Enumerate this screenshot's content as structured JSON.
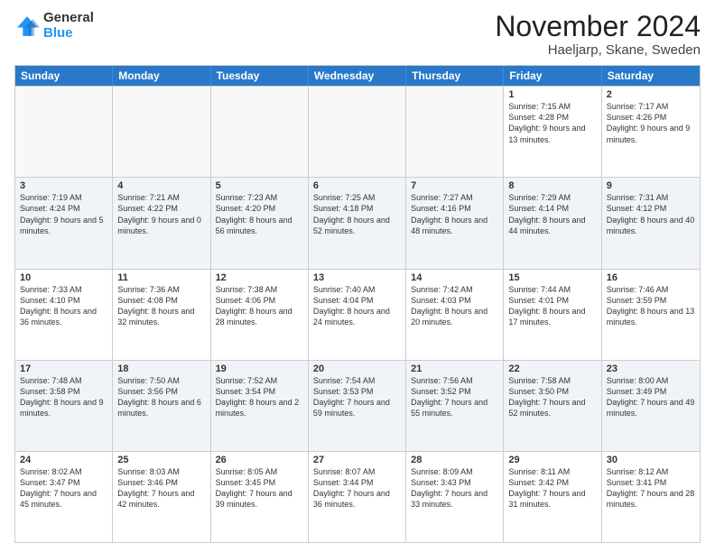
{
  "logo": {
    "general": "General",
    "blue": "Blue"
  },
  "title": "November 2024",
  "location": "Haeljarp, Skane, Sweden",
  "header": {
    "days": [
      "Sunday",
      "Monday",
      "Tuesday",
      "Wednesday",
      "Thursday",
      "Friday",
      "Saturday"
    ]
  },
  "weeks": [
    {
      "cells": [
        {
          "day": "",
          "empty": true
        },
        {
          "day": "",
          "empty": true
        },
        {
          "day": "",
          "empty": true
        },
        {
          "day": "",
          "empty": true
        },
        {
          "day": "",
          "empty": true
        },
        {
          "day": "1",
          "sunrise": "Sunrise: 7:15 AM",
          "sunset": "Sunset: 4:28 PM",
          "daylight": "Daylight: 9 hours and 13 minutes."
        },
        {
          "day": "2",
          "sunrise": "Sunrise: 7:17 AM",
          "sunset": "Sunset: 4:26 PM",
          "daylight": "Daylight: 9 hours and 9 minutes."
        }
      ]
    },
    {
      "cells": [
        {
          "day": "3",
          "sunrise": "Sunrise: 7:19 AM",
          "sunset": "Sunset: 4:24 PM",
          "daylight": "Daylight: 9 hours and 5 minutes."
        },
        {
          "day": "4",
          "sunrise": "Sunrise: 7:21 AM",
          "sunset": "Sunset: 4:22 PM",
          "daylight": "Daylight: 9 hours and 0 minutes."
        },
        {
          "day": "5",
          "sunrise": "Sunrise: 7:23 AM",
          "sunset": "Sunset: 4:20 PM",
          "daylight": "Daylight: 8 hours and 56 minutes."
        },
        {
          "day": "6",
          "sunrise": "Sunrise: 7:25 AM",
          "sunset": "Sunset: 4:18 PM",
          "daylight": "Daylight: 8 hours and 52 minutes."
        },
        {
          "day": "7",
          "sunrise": "Sunrise: 7:27 AM",
          "sunset": "Sunset: 4:16 PM",
          "daylight": "Daylight: 8 hours and 48 minutes."
        },
        {
          "day": "8",
          "sunrise": "Sunrise: 7:29 AM",
          "sunset": "Sunset: 4:14 PM",
          "daylight": "Daylight: 8 hours and 44 minutes."
        },
        {
          "day": "9",
          "sunrise": "Sunrise: 7:31 AM",
          "sunset": "Sunset: 4:12 PM",
          "daylight": "Daylight: 8 hours and 40 minutes."
        }
      ]
    },
    {
      "cells": [
        {
          "day": "10",
          "sunrise": "Sunrise: 7:33 AM",
          "sunset": "Sunset: 4:10 PM",
          "daylight": "Daylight: 8 hours and 36 minutes."
        },
        {
          "day": "11",
          "sunrise": "Sunrise: 7:36 AM",
          "sunset": "Sunset: 4:08 PM",
          "daylight": "Daylight: 8 hours and 32 minutes."
        },
        {
          "day": "12",
          "sunrise": "Sunrise: 7:38 AM",
          "sunset": "Sunset: 4:06 PM",
          "daylight": "Daylight: 8 hours and 28 minutes."
        },
        {
          "day": "13",
          "sunrise": "Sunrise: 7:40 AM",
          "sunset": "Sunset: 4:04 PM",
          "daylight": "Daylight: 8 hours and 24 minutes."
        },
        {
          "day": "14",
          "sunrise": "Sunrise: 7:42 AM",
          "sunset": "Sunset: 4:03 PM",
          "daylight": "Daylight: 8 hours and 20 minutes."
        },
        {
          "day": "15",
          "sunrise": "Sunrise: 7:44 AM",
          "sunset": "Sunset: 4:01 PM",
          "daylight": "Daylight: 8 hours and 17 minutes."
        },
        {
          "day": "16",
          "sunrise": "Sunrise: 7:46 AM",
          "sunset": "Sunset: 3:59 PM",
          "daylight": "Daylight: 8 hours and 13 minutes."
        }
      ]
    },
    {
      "cells": [
        {
          "day": "17",
          "sunrise": "Sunrise: 7:48 AM",
          "sunset": "Sunset: 3:58 PM",
          "daylight": "Daylight: 8 hours and 9 minutes."
        },
        {
          "day": "18",
          "sunrise": "Sunrise: 7:50 AM",
          "sunset": "Sunset: 3:56 PM",
          "daylight": "Daylight: 8 hours and 6 minutes."
        },
        {
          "day": "19",
          "sunrise": "Sunrise: 7:52 AM",
          "sunset": "Sunset: 3:54 PM",
          "daylight": "Daylight: 8 hours and 2 minutes."
        },
        {
          "day": "20",
          "sunrise": "Sunrise: 7:54 AM",
          "sunset": "Sunset: 3:53 PM",
          "daylight": "Daylight: 7 hours and 59 minutes."
        },
        {
          "day": "21",
          "sunrise": "Sunrise: 7:56 AM",
          "sunset": "Sunset: 3:52 PM",
          "daylight": "Daylight: 7 hours and 55 minutes."
        },
        {
          "day": "22",
          "sunrise": "Sunrise: 7:58 AM",
          "sunset": "Sunset: 3:50 PM",
          "daylight": "Daylight: 7 hours and 52 minutes."
        },
        {
          "day": "23",
          "sunrise": "Sunrise: 8:00 AM",
          "sunset": "Sunset: 3:49 PM",
          "daylight": "Daylight: 7 hours and 49 minutes."
        }
      ]
    },
    {
      "cells": [
        {
          "day": "24",
          "sunrise": "Sunrise: 8:02 AM",
          "sunset": "Sunset: 3:47 PM",
          "daylight": "Daylight: 7 hours and 45 minutes."
        },
        {
          "day": "25",
          "sunrise": "Sunrise: 8:03 AM",
          "sunset": "Sunset: 3:46 PM",
          "daylight": "Daylight: 7 hours and 42 minutes."
        },
        {
          "day": "26",
          "sunrise": "Sunrise: 8:05 AM",
          "sunset": "Sunset: 3:45 PM",
          "daylight": "Daylight: 7 hours and 39 minutes."
        },
        {
          "day": "27",
          "sunrise": "Sunrise: 8:07 AM",
          "sunset": "Sunset: 3:44 PM",
          "daylight": "Daylight: 7 hours and 36 minutes."
        },
        {
          "day": "28",
          "sunrise": "Sunrise: 8:09 AM",
          "sunset": "Sunset: 3:43 PM",
          "daylight": "Daylight: 7 hours and 33 minutes."
        },
        {
          "day": "29",
          "sunrise": "Sunrise: 8:11 AM",
          "sunset": "Sunset: 3:42 PM",
          "daylight": "Daylight: 7 hours and 31 minutes."
        },
        {
          "day": "30",
          "sunrise": "Sunrise: 8:12 AM",
          "sunset": "Sunset: 3:41 PM",
          "daylight": "Daylight: 7 hours and 28 minutes."
        }
      ]
    }
  ]
}
